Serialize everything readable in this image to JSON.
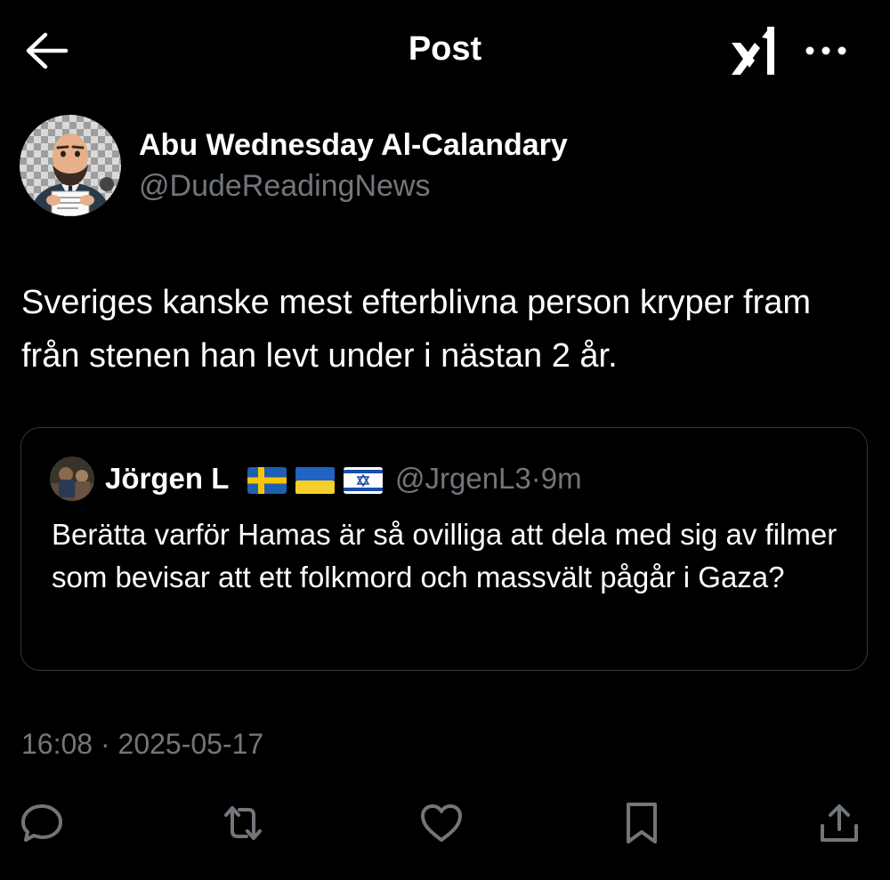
{
  "header": {
    "title": "Post",
    "back_icon": "back-arrow-icon",
    "grok_icon": "grok-icon",
    "more_icon": "more-icon"
  },
  "post": {
    "author_name": "Abu Wednesday Al-Calandary",
    "author_handle": "@DudeReadingNews",
    "text": "Sveriges kanske mest efterblivna person kryper fram från stenen han levt under i nästan 2 år.",
    "timestamp": "16:08 · 2025-05-17"
  },
  "quoted_post": {
    "author_name": "Jörgen L",
    "flags": [
      "sweden-flag",
      "ukraine-flag",
      "israel-flag"
    ],
    "author_handle": "@JrgenL3",
    "separator": "·",
    "age": "9m",
    "text": "Berätta varför Hamas är så ovilliga att dela med sig av filmer som bevisar att ett folkmord och massvält pågår i Gaza?"
  },
  "actions": {
    "icons": [
      "reply-icon",
      "repost-icon",
      "like-icon",
      "bookmark-icon",
      "share-icon"
    ]
  },
  "colors": {
    "background": "#000000",
    "primary_text": "#e7e9ea",
    "secondary_text": "#71767b",
    "border": "#333639"
  }
}
